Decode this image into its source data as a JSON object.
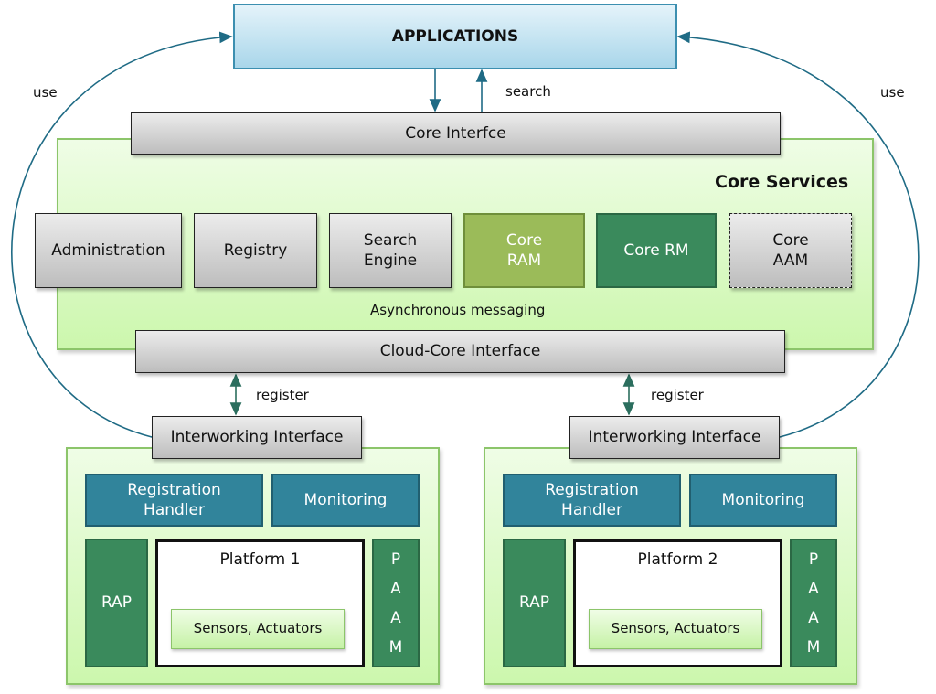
{
  "applications": "APPLICATIONS",
  "search_label": "search",
  "use_left": "use",
  "use_right": "use",
  "core_interface": "Core Interfce",
  "core_services": {
    "title": "Core Services",
    "components": [
      "Administration",
      "Registry",
      "Search Engine",
      "Core RAM",
      "Core RM",
      "Core AAM"
    ],
    "async": "Asynchronous messaging"
  },
  "cloud_core_interface": "Cloud-Core Interface",
  "register_left": "register",
  "register_right": "register",
  "platforms": [
    {
      "interface": "Interworking Interface",
      "registration": "Registration Handler",
      "monitoring": "Monitoring",
      "rap": "RAP",
      "name": "Platform 1",
      "sensors": "Sensors, Actuators",
      "paam": "P A A M"
    },
    {
      "interface": "Interworking Interface",
      "registration": "Registration Handler",
      "monitoring": "Monitoring",
      "rap": "RAP",
      "name": "Platform 2",
      "sensors": "Sensors, Actuators",
      "paam": "P A A M"
    }
  ],
  "colors": {
    "arrow": "#1f6b85",
    "teal": "#31849b",
    "dark_green": "#3a8a5c",
    "light_green": "#9bbb59"
  }
}
